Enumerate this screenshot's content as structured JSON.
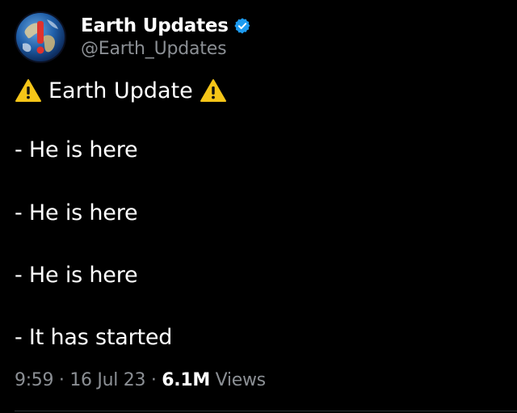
{
  "author": {
    "display_name": "Earth Updates",
    "handle": "@Earth_Updates",
    "verified": true,
    "avatar_icon": "earth-globe-with-exclamation-icon"
  },
  "post": {
    "headline": "Earth Update",
    "headline_icon": "warning-icon",
    "lines": [
      "- He is here",
      "- He is here",
      "- He is here",
      "- It has started"
    ]
  },
  "meta": {
    "time": "9:59",
    "separator": "·",
    "date": "16 Jul 23",
    "views_count": "6.1M",
    "views_label": "Views"
  },
  "colors": {
    "background": "#000000",
    "text": "#ffffff",
    "muted": "#8b8f94",
    "verified_badge": "#1d9bf0",
    "warning": "#f5c518"
  }
}
